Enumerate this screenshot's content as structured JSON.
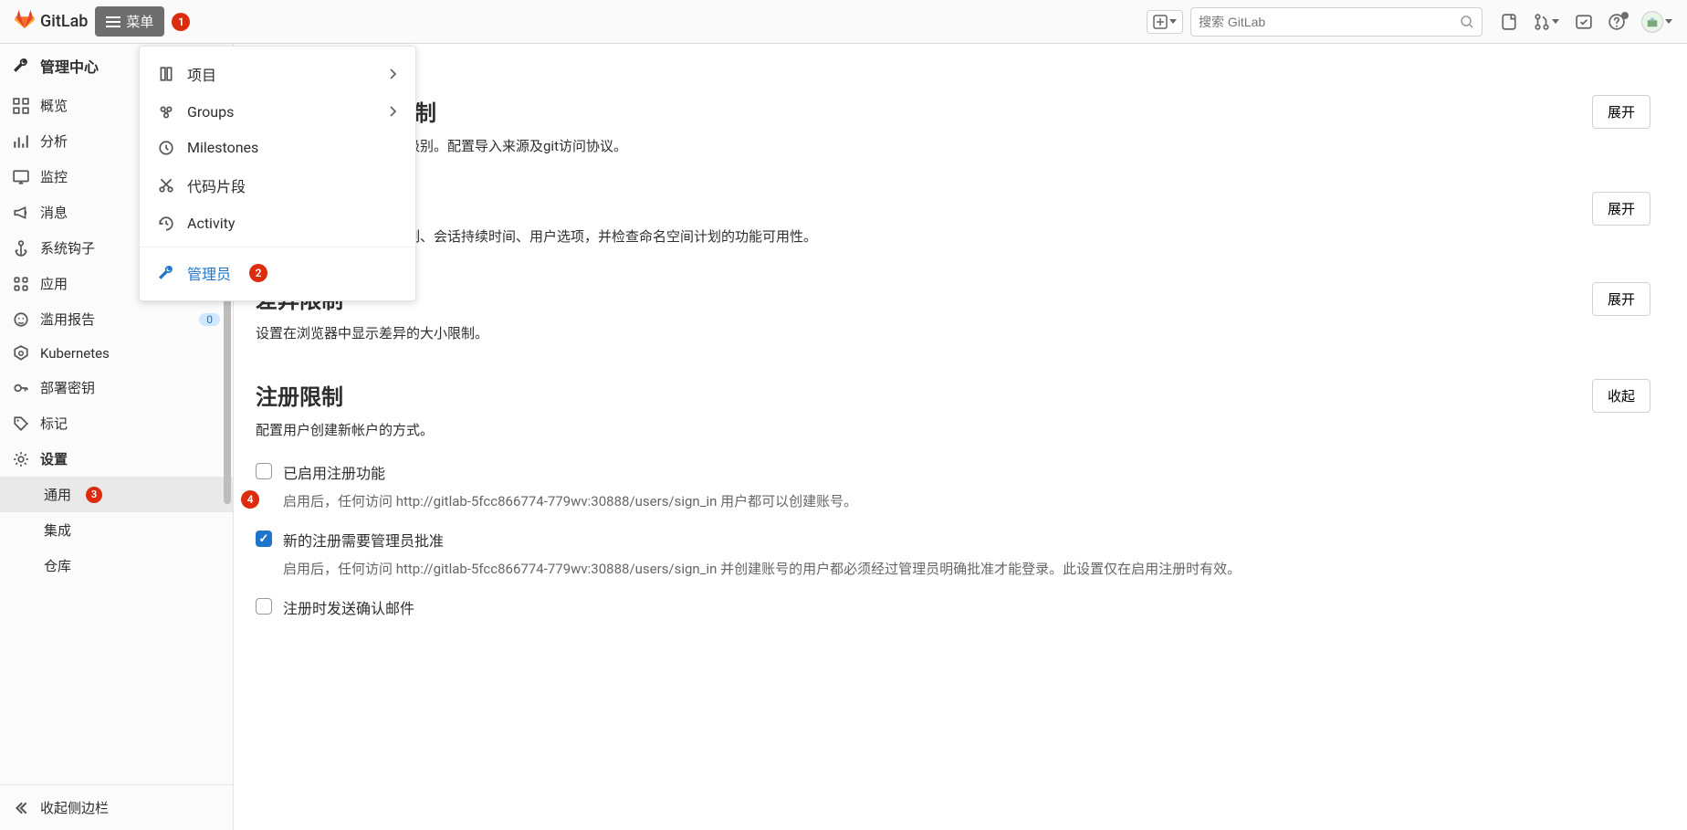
{
  "header": {
    "brand": "GitLab",
    "menu_label": "菜单",
    "menu_badge": "1",
    "search_placeholder": "搜索 GitLab"
  },
  "dropdown": {
    "items": [
      {
        "label": "项目",
        "icon": "book",
        "has_sub": true
      },
      {
        "label": "Groups",
        "icon": "group",
        "has_sub": true
      },
      {
        "label": "Milestones",
        "icon": "clock",
        "has_sub": false
      },
      {
        "label": "代码片段",
        "icon": "scissors",
        "has_sub": false
      },
      {
        "label": "Activity",
        "icon": "history",
        "has_sub": false
      }
    ],
    "admin_label": "管理员",
    "admin_badge": "2"
  },
  "sidebar": {
    "title": "管理中心",
    "items": [
      {
        "label": "概览",
        "icon": "overview"
      },
      {
        "label": "分析",
        "icon": "chart"
      },
      {
        "label": "监控",
        "icon": "monitor"
      },
      {
        "label": "消息",
        "icon": "megaphone"
      },
      {
        "label": "系统钩子",
        "icon": "anchor"
      },
      {
        "label": "应用",
        "icon": "apps"
      },
      {
        "label": "滥用报告",
        "icon": "face",
        "pill": "0"
      },
      {
        "label": "Kubernetes",
        "icon": "kube"
      },
      {
        "label": "部署密钥",
        "icon": "key"
      },
      {
        "label": "标记",
        "icon": "tag"
      },
      {
        "label": "设置",
        "icon": "gear"
      }
    ],
    "sub_items": [
      {
        "label": "通用",
        "badge": "3",
        "active": true
      },
      {
        "label": "集成"
      },
      {
        "label": "仓库"
      }
    ],
    "collapse_label": "收起侧边栏"
  },
  "sections": [
    {
      "title_partial": "控制",
      "desc_partial": "性级别。配置导入来源及git访问协议。",
      "button": "展开"
    },
    {
      "desc_partial": "限制、会话持续时间、用户选项，并检查命名空间计划的功能可用性。",
      "button": "展开"
    },
    {
      "title": "差异限制",
      "desc": "设置在浏览器中显示差异的大小限制。",
      "button": "展开"
    },
    {
      "title": "注册限制",
      "desc": "配置用户创建新帐户的方式。",
      "button": "收起"
    }
  ],
  "signup": {
    "marker_4": "4",
    "check1_label": "已启用注册功能",
    "check1_desc": "启用后，任何访问 http://gitlab-5fcc866774-779wv:30888/users/sign_in 用户都可以创建账号。",
    "check2_label": "新的注册需要管理员批准",
    "check2_desc": "启用后，任何访问 http://gitlab-5fcc866774-779wv:30888/users/sign_in 并创建账号的用户都必须经过管理员明确批准才能登录。此设置仅在启用注册时有效。",
    "check3_label": "注册时发送确认邮件"
  }
}
